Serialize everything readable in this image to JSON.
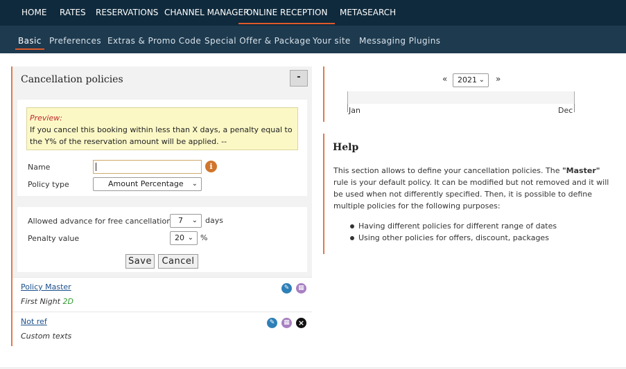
{
  "top_nav": {
    "items": [
      {
        "label": "HOME"
      },
      {
        "label": "RATES"
      },
      {
        "label": "RESERVATIONS"
      },
      {
        "label": "CHANNEL MANAGER"
      },
      {
        "label": "ONLINE RECEPTION"
      },
      {
        "label": "METASEARCH"
      }
    ],
    "active": "ONLINE RECEPTION"
  },
  "sub_nav": {
    "items": [
      {
        "label": "Basic"
      },
      {
        "label": "Preferences"
      },
      {
        "label": "Extras & Promo Code"
      },
      {
        "label": "Special Offer & Package"
      },
      {
        "label": "Your site"
      },
      {
        "label": "Messaging Plugins"
      }
    ],
    "active": "Basic"
  },
  "cancellation": {
    "title": "Cancellation policies",
    "collapse_label": "-",
    "preview_label": "Preview:",
    "preview_text": "If you cancel this booking within less than X days, a penalty equal to the Y% of the reservation amount will be applied. --",
    "name_label": "Name",
    "name_value": "",
    "info_icon": "i",
    "policy_type_label": "Policy type",
    "policy_type_value": "Amount Percentage",
    "advance_label": "Allowed advance for free cancellation",
    "advance_value": "7",
    "advance_unit": "days",
    "penalty_label": "Penalty value",
    "penalty_value": "20",
    "penalty_unit": "%",
    "save_label": "Save",
    "cancel_label": "Cancel"
  },
  "policies": [
    {
      "name": "Policy Master",
      "sub_prefix": "First Night",
      "sub_highlight": "2D",
      "actions": [
        "edit-icon",
        "calendar-icon"
      ]
    },
    {
      "name": "Not ref",
      "sub_prefix": "Custom texts",
      "sub_highlight": "",
      "actions": [
        "edit-icon",
        "calendar-icon",
        "delete-icon"
      ]
    }
  ],
  "calendar": {
    "prev": "«",
    "next": "»",
    "year": "2021",
    "start_month": "Jan",
    "end_month": "Dec"
  },
  "help": {
    "title": "Help",
    "text_before": "This section allows to define your cancellation policies. The ",
    "text_bold": "\"Master\"",
    "text_after": " rule is your default policy. It can be modified but not removed and it will be used when not differently specified. Then, it is possible to define multiple policies for the following purposes:",
    "bullets": [
      "Having different policies for different range of dates",
      "Using other policies for offers, discount, packages"
    ]
  },
  "colors": {
    "top_nav_bg": "#0f2a3c",
    "sub_nav_bg": "#1e3a4f",
    "accent": "#e05a2b",
    "link": "#1a4f8b"
  }
}
